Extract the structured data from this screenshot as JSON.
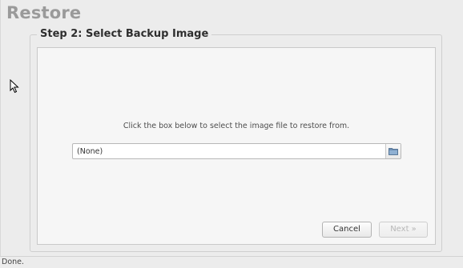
{
  "app": {
    "title": "Restore"
  },
  "step": {
    "title": "Step 2: Select Backup Image"
  },
  "panel": {
    "instruction": "Click the box below to select the image file to restore from.",
    "file_picker": {
      "value": "(None)",
      "browse_icon": "folder-icon"
    }
  },
  "buttons": {
    "cancel": "Cancel",
    "next": "Next »"
  },
  "status": {
    "text": "Done."
  },
  "colors": {
    "title": "#9a9a9a",
    "panel_bg": "#f6f6f6",
    "window_bg": "#ececec"
  }
}
